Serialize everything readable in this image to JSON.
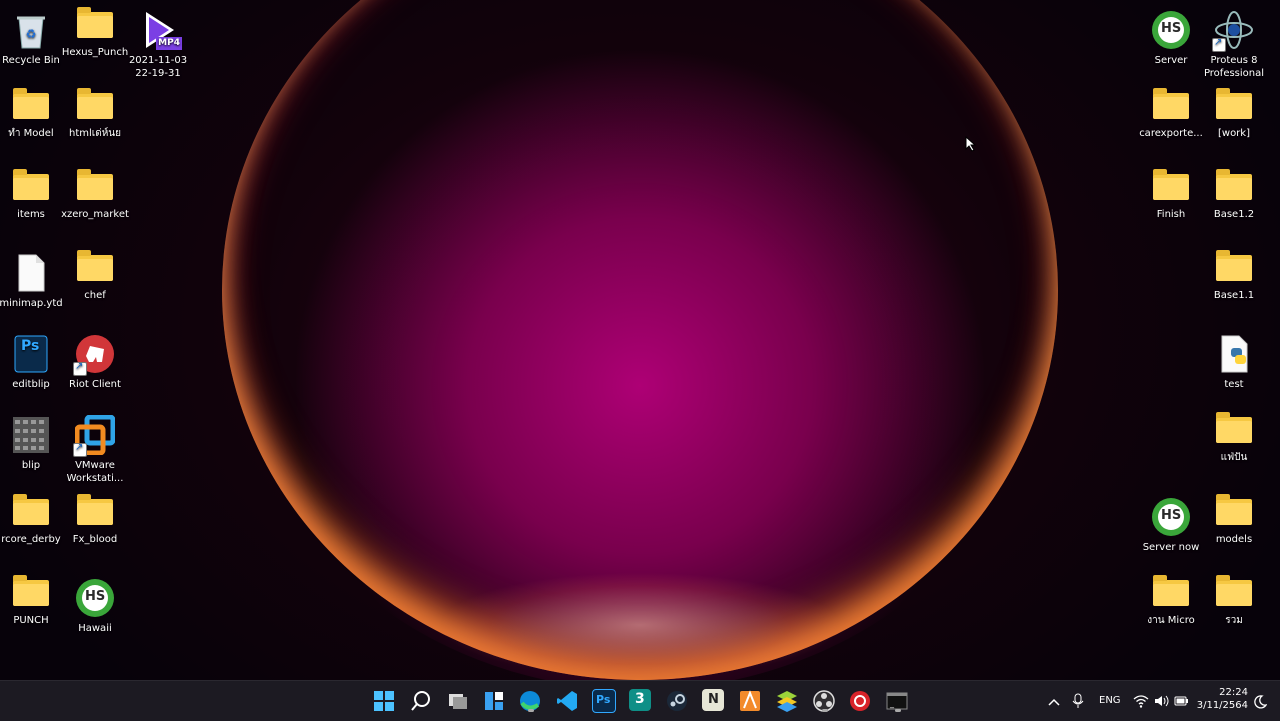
{
  "desktop": {
    "left_icons": [
      {
        "label": "Recycle Bin"
      },
      {
        "label": "Hexus_Punch"
      },
      {
        "label": "2021-11-03\n22-19-31",
        "badge": "MP4"
      },
      {
        "label": "ทำ Model"
      },
      {
        "label": "htmlเด่ห์นย"
      },
      {
        "label": "items"
      },
      {
        "label": "xzero_market"
      },
      {
        "label": "minimap.ytd"
      },
      {
        "label": "chef"
      },
      {
        "label": "editblip",
        "badge": "Ps"
      },
      {
        "label": "Riot Client"
      },
      {
        "label": "blip"
      },
      {
        "label": "VMware\nWorkstati..."
      },
      {
        "label": "rcore_derby"
      },
      {
        "label": "Fx_blood"
      },
      {
        "label": "PUNCH"
      },
      {
        "label": "Hawaii",
        "badge": "HS"
      }
    ],
    "right_icons": [
      {
        "label": "Server",
        "badge": "HS"
      },
      {
        "label": "Proteus 8\nProfessional"
      },
      {
        "label": "carexporte..."
      },
      {
        "label": "[work]"
      },
      {
        "label": "Finish"
      },
      {
        "label": "Base1.2"
      },
      {
        "label": "Base1.1"
      },
      {
        "label": "test"
      },
      {
        "label": "แฟ่ปัน"
      },
      {
        "label": "Server now",
        "badge": "HS"
      },
      {
        "label": "models"
      },
      {
        "label": "งาน Micro"
      },
      {
        "label": "รวม"
      }
    ]
  },
  "taskbar": {
    "apps": [
      {
        "name": "start-icon"
      },
      {
        "name": "search-icon"
      },
      {
        "name": "task-view-icon"
      },
      {
        "name": "widgets-icon"
      },
      {
        "name": "edge-icon"
      },
      {
        "name": "vscode-icon"
      },
      {
        "name": "photoshop-icon",
        "text": "Ps"
      },
      {
        "name": "3ds-max-icon",
        "text": "3"
      },
      {
        "name": "steam-icon"
      },
      {
        "name": "nvim-icon",
        "text": "N"
      },
      {
        "name": "sublime-icon"
      },
      {
        "name": "bluestacks-icon"
      },
      {
        "name": "obs-icon"
      },
      {
        "name": "garena-icon"
      },
      {
        "name": "terminal-icon"
      }
    ],
    "tray": {
      "language": "ENG",
      "time": "22:24",
      "date": "3/11/2564"
    }
  },
  "colors": {
    "folder": "#f6c842",
    "taskbar": "#1c1a22"
  }
}
